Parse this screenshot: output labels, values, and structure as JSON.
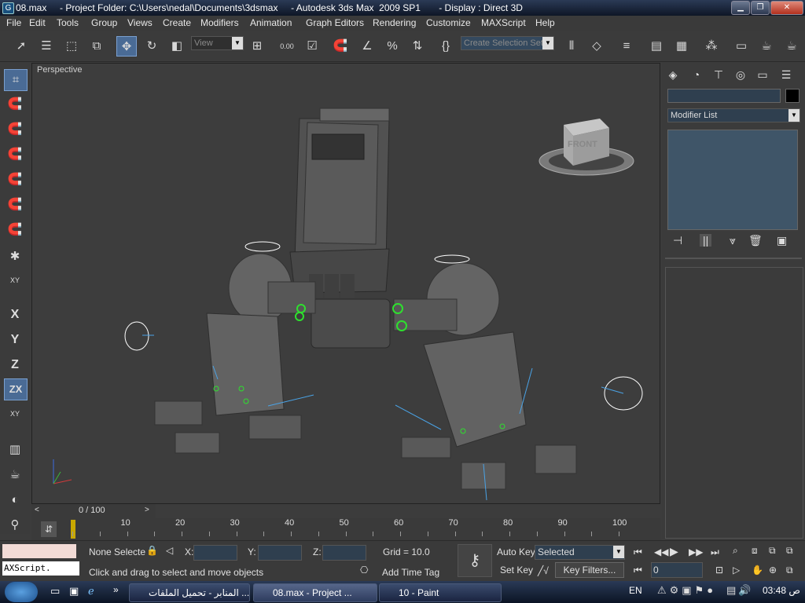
{
  "window": {
    "title": "08.max     - Project Folder: C:\\Users\\nedal\\Documents\\3dsmax     - Autodesk 3ds Max  2009 SP1       - Display : Direct 3D",
    "icon_label": "G"
  },
  "menu": [
    "File",
    "Edit",
    "Tools",
    "Group",
    "Views",
    "Create",
    "Modifiers",
    "Animation",
    "Graph Editors",
    "Rendering",
    "Customize",
    "MAXScript",
    "Help"
  ],
  "toolbar": {
    "view_dropdown": "View",
    "selection_set_placeholder": "Create Selection Set",
    "spinner_label": "0.00"
  },
  "left_toolbar": {
    "axes": [
      "X",
      "Y",
      "Z",
      "ZX"
    ],
    "xy_label": "XY"
  },
  "viewport": {
    "label": "Perspective",
    "viewcube_label": "FRONT"
  },
  "command_panel": {
    "modifier_list": "Modifier List"
  },
  "time_slider": {
    "label": "0 / 100"
  },
  "timeline": {
    "ticks": [
      "10",
      "20",
      "30",
      "40",
      "50",
      "60",
      "70",
      "80",
      "90",
      "100"
    ]
  },
  "status": {
    "selection": "None Selecte",
    "x_label": "X:",
    "y_label": "Y:",
    "z_label": "Z:",
    "grid": "Grid = 10.0",
    "prompt": "Click and drag to select and move objects",
    "add_time_tag": "Add Time Tag",
    "auto_key": "Auto Key",
    "set_key": "Set Key",
    "selected_dropdown": "Selected",
    "key_filters": "Key Filters...",
    "frame": "0",
    "maxscript": "AXScript."
  },
  "taskbar": {
    "tasks": [
      "المنابر - تحميل الملفات ...",
      "08.max     - Project ...",
      "10 - Paint"
    ],
    "language": "EN",
    "clock": "03:48 ص"
  },
  "colors": {
    "accent": "#4a6b95",
    "viewport_bg": "#3d3d3d",
    "selection_green": "#2ee02e"
  }
}
